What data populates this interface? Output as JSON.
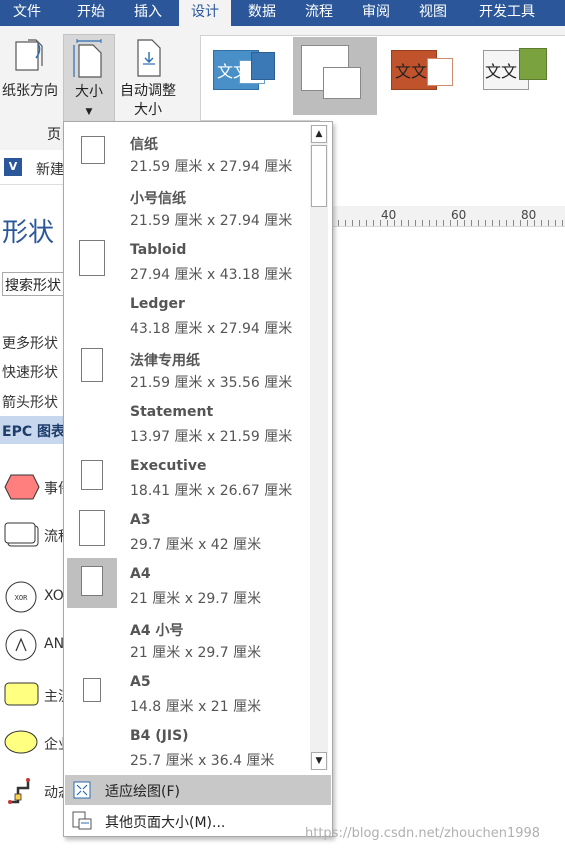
{
  "tabs": [
    "文件",
    "开始",
    "插入",
    "设计",
    "数据",
    "流程",
    "审阅",
    "视图",
    "开发工具"
  ],
  "active_tab": "设计",
  "ribbon": {
    "orientation_label": "纸张方向",
    "size_label": "大小",
    "autofit_label_1": "自动调整",
    "autofit_label_2": "大小",
    "group_label": "页",
    "theme_text": "文文",
    "theme_colors": [
      "#4a90c8",
      "#ffffff",
      "#c0532b",
      "#7aa33f"
    ]
  },
  "left_pane": {
    "doc_label": "新建",
    "shapes_title": "形状",
    "search_placeholder": "搜索形状",
    "more_shapes": "更多形状",
    "quick_shapes": "快速形状",
    "arrow_shapes": "箭头形状",
    "epc_header": "EPC 图表",
    "stencils": [
      {
        "label": "事件",
        "icon": "event-hexagon-icon"
      },
      {
        "label": "流程",
        "icon": "process-box-icon"
      },
      {
        "label": "XOR",
        "icon": "xor-circle-icon",
        "glyph": "XOR"
      },
      {
        "label": "AND",
        "icon": "and-circle-icon",
        "glyph": "∧"
      },
      {
        "label": "主流",
        "icon": "main-flow-icon"
      },
      {
        "label": "企业",
        "icon": "enterprise-ellipse-icon"
      },
      {
        "label": "动态",
        "icon": "dynamic-connector-icon"
      }
    ]
  },
  "ruler_ticks": [
    "40",
    "60",
    "80"
  ],
  "dropdown": {
    "items": [
      {
        "name": "信纸",
        "size": "21.59 厘米 x 27.94 厘米"
      },
      {
        "name": "小号信纸",
        "size": "21.59 厘米 x 27.94 厘米"
      },
      {
        "name": "Tabloid",
        "size": "27.94 厘米 x 43.18 厘米"
      },
      {
        "name": "Ledger",
        "size": "43.18 厘米 x 27.94 厘米"
      },
      {
        "name": "法律专用纸",
        "size": "21.59 厘米 x 35.56 厘米"
      },
      {
        "name": "Statement",
        "size": "13.97 厘米 x 21.59 厘米"
      },
      {
        "name": "Executive",
        "size": "18.41 厘米 x 26.67 厘米"
      },
      {
        "name": "A3",
        "size": "29.7 厘米 x 42 厘米"
      },
      {
        "name": "A4",
        "size": "21 厘米 x 29.7 厘米"
      },
      {
        "name": "A4 小号",
        "size": "21 厘米 x 29.7 厘米"
      },
      {
        "name": "A5",
        "size": "14.8 厘米 x 21 厘米"
      },
      {
        "name": "B4 (JIS)",
        "size": "25.7 厘米 x 36.4 厘米"
      }
    ],
    "selected": "A4",
    "fit_to_drawing": "适应绘图(F)",
    "more_page_sizes": "其他页面大小(M)..."
  },
  "watermark": "https://blog.csdn.net/zhouchen1998"
}
